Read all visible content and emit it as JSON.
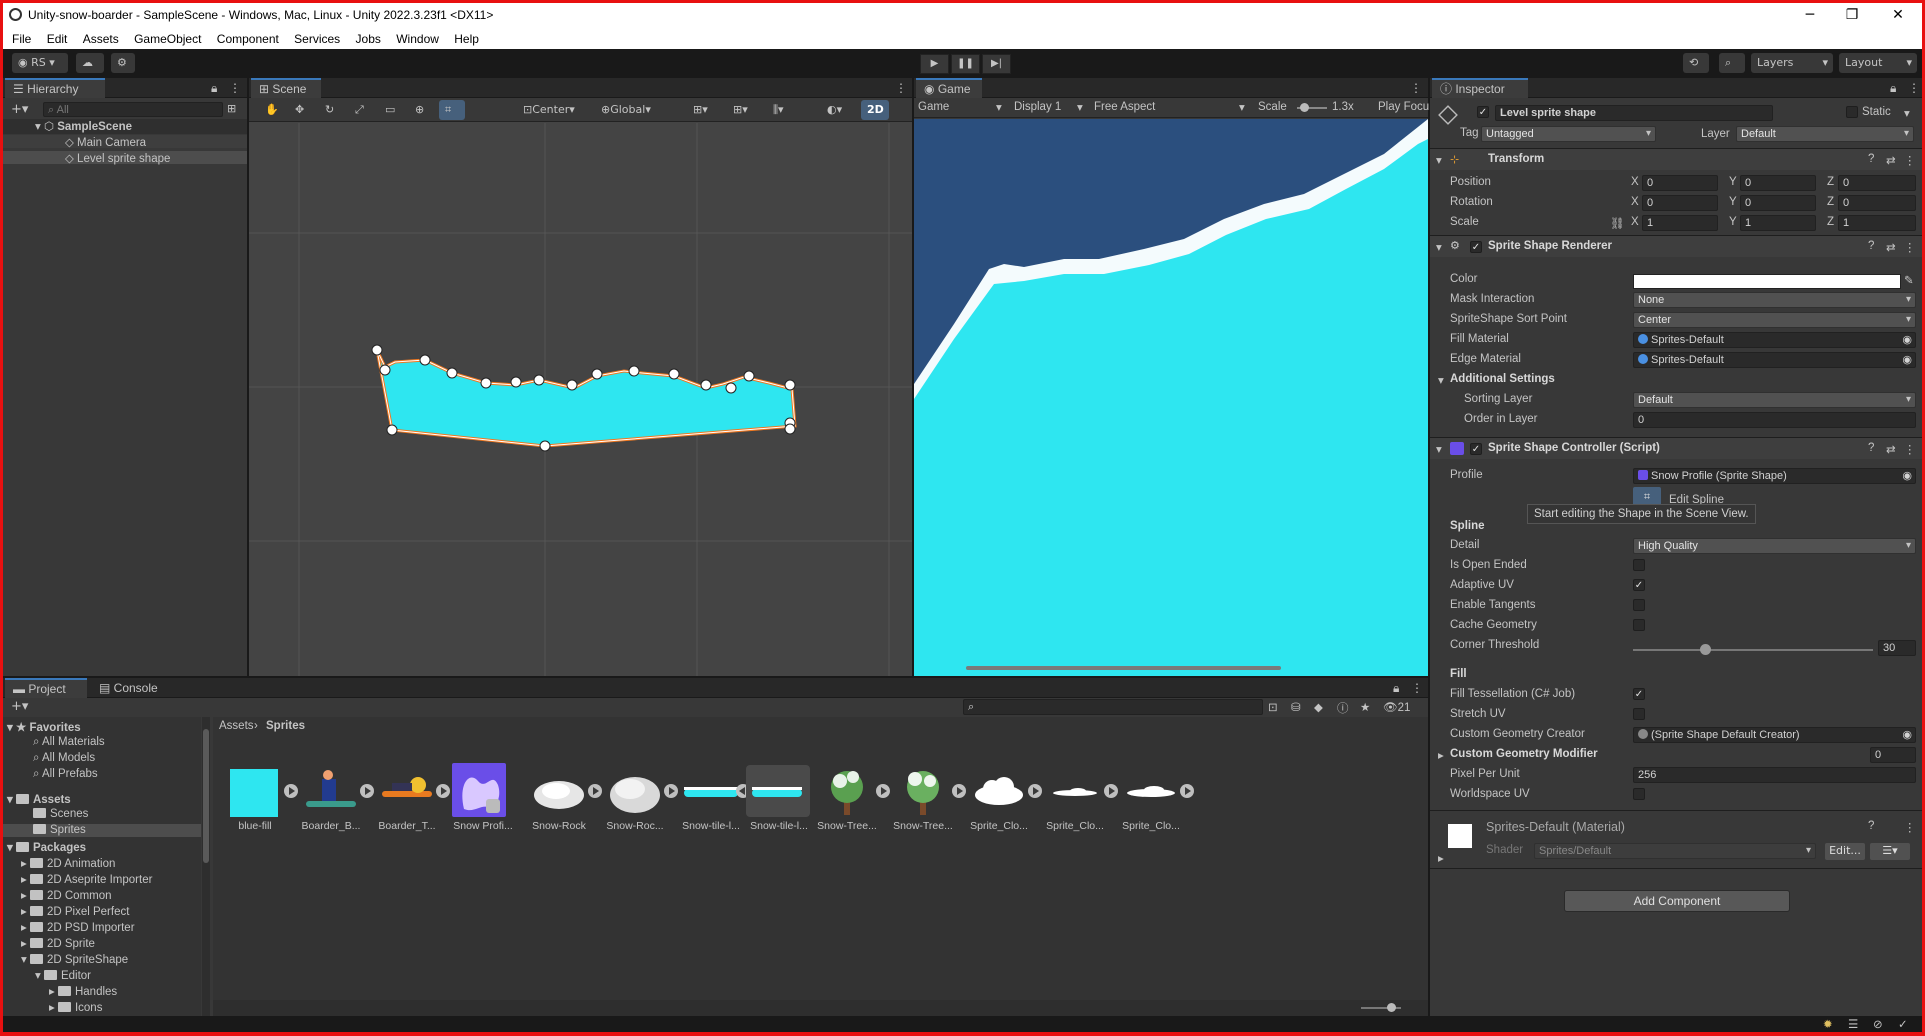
{
  "window": {
    "title": "Unity-snow-boarder - SampleScene - Windows, Mac, Linux - Unity 2022.3.23f1 <DX11>"
  },
  "menu": [
    "File",
    "Edit",
    "Assets",
    "GameObject",
    "Component",
    "Services",
    "Jobs",
    "Window",
    "Help"
  ],
  "toolbar": {
    "account": "RS",
    "layers": "Layers",
    "layout": "Layout"
  },
  "hierarchy": {
    "tab": "Hierarchy",
    "search_placeholder": "All",
    "scene": "SampleScene",
    "items": [
      "Main Camera",
      "Level sprite shape"
    ]
  },
  "scene": {
    "tab": "Scene",
    "pivot": "Center",
    "space": "Global",
    "mode_2d": "2D"
  },
  "game": {
    "tab": "Game",
    "mode": "Game",
    "display": "Display 1",
    "aspect": "Free Aspect",
    "scale_label": "Scale",
    "scale_value": "1.3x",
    "play_focused": "Play Focu",
    "colors": {
      "sky": "#2b4f7e",
      "snow": "#2ee6f0"
    }
  },
  "inspector": {
    "tab": "Inspector",
    "object_name": "Level sprite shape",
    "static_label": "Static",
    "tag_label": "Tag",
    "tag_value": "Untagged",
    "layer_label": "Layer",
    "layer_value": "Default",
    "transform": {
      "title": "Transform",
      "position_label": "Position",
      "rotation_label": "Rotation",
      "scale_label": "Scale",
      "x": "X",
      "y": "Y",
      "z": "Z",
      "position": [
        "0",
        "0",
        "0"
      ],
      "rotation": [
        "0",
        "0",
        "0"
      ],
      "scale": [
        "1",
        "1",
        "1"
      ]
    },
    "renderer": {
      "title": "Sprite Shape Renderer",
      "color_label": "Color",
      "mask_label": "Mask Interaction",
      "mask_value": "None",
      "sort_label": "SpriteShape Sort Point",
      "sort_value": "Center",
      "fill_mat_label": "Fill Material",
      "fill_mat_value": "Sprites-Default",
      "edge_mat_label": "Edge Material",
      "edge_mat_value": "Sprites-Default",
      "additional": "Additional Settings",
      "sorting_layer_label": "Sorting Layer",
      "sorting_layer_value": "Default",
      "order_label": "Order in Layer",
      "order_value": "0"
    },
    "controller": {
      "title": "Sprite Shape Controller (Script)",
      "profile_label": "Profile",
      "profile_value": "Snow Profile (Sprite Shape)",
      "edit_spline": "Edit Spline",
      "tooltip": "Start editing the Shape in the Scene View.",
      "spline_header": "Spline",
      "detail_label": "Detail",
      "detail_value": "High Quality",
      "open_ended": "Is Open Ended",
      "adaptive_uv": "Adaptive UV",
      "tangents": "Enable Tangents",
      "cache": "Cache Geometry",
      "corner_label": "Corner Threshold",
      "corner_value": "30",
      "corner_fraction": 0.3,
      "fill_header": "Fill",
      "fill_tess": "Fill Tessellation (C# Job)",
      "stretch_uv": "Stretch UV",
      "custom_creator_label": "Custom Geometry Creator",
      "custom_creator_value": "(Sprite Shape Default Creator)",
      "custom_modifier": "Custom Geometry Modifier",
      "modifier_count": "0",
      "ppu_label": "Pixel Per Unit",
      "ppu_value": "256",
      "worldspace": "Worldspace UV"
    },
    "material": {
      "name": "Sprites-Default (Material)",
      "shader_label": "Shader",
      "shader_value": "Sprites/Default",
      "edit": "Edit..."
    },
    "add_component": "Add Component"
  },
  "project": {
    "tab_project": "Project",
    "tab_console": "Console",
    "hidden_count": "21",
    "breadcrumb": [
      "Assets",
      "Sprites"
    ],
    "favorites": "Favorites",
    "fav_items": [
      "All Materials",
      "All Models",
      "All Prefabs"
    ],
    "assets": "Assets",
    "asset_items": [
      "Scenes",
      "Sprites"
    ],
    "packages": "Packages",
    "package_items": [
      "2D Animation",
      "2D Aseprite Importer",
      "2D Common",
      "2D Pixel Perfect",
      "2D PSD Importer",
      "2D Sprite",
      "2D SpriteShape"
    ],
    "sub_items": [
      "Editor",
      "Handles",
      "Icons"
    ],
    "grid": [
      "blue-fill",
      "Boarder_B...",
      "Boarder_T...",
      "Snow Profi...",
      "Snow-Rock",
      "Snow-Roc...",
      "Snow-tile-l...",
      "Snow-tile-l...",
      "Snow-Tree...",
      "Snow-Tree...",
      "Sprite_Clo...",
      "Sprite_Clo...",
      "Sprite_Clo..."
    ]
  }
}
